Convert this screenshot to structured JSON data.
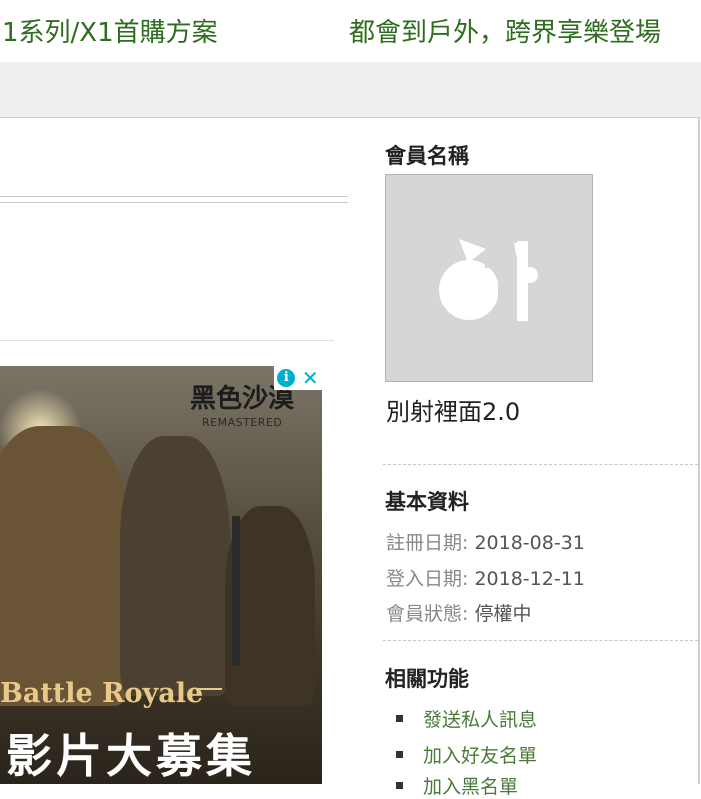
{
  "top_links": {
    "left": "1系列/X1首購方案",
    "right": "都會到戶外，跨界享樂登場"
  },
  "ad": {
    "logo_text": "黑色沙漠",
    "remastered": "REMASTERED",
    "battle_text": "Battle Royale",
    "headline": "影片大募集",
    "info_glyph": "i",
    "close_glyph": "✕"
  },
  "sidebar": {
    "member_title": "會員名稱",
    "member_name": "別射裡面2.0",
    "basic_title": "基本資料",
    "info": [
      {
        "label": "註冊日期:",
        "value": "2018-08-31"
      },
      {
        "label": "登入日期:",
        "value": "2018-12-11"
      },
      {
        "label": "會員狀態:",
        "value": "停權中"
      }
    ],
    "func_title": "相關功能",
    "functions": [
      "發送私人訊息",
      "加入好友名單",
      "加入黑名單"
    ]
  },
  "colors": {
    "link_green": "#2e6d1f",
    "func_green": "#4a7a3a",
    "gray_bar": "#efefef",
    "ad_accent": "#00aecd"
  },
  "icons": {
    "avatar": "default-avatar-icon",
    "ad_info": "info-icon",
    "ad_close": "close-icon",
    "bullet": "square-bullet-icon"
  }
}
